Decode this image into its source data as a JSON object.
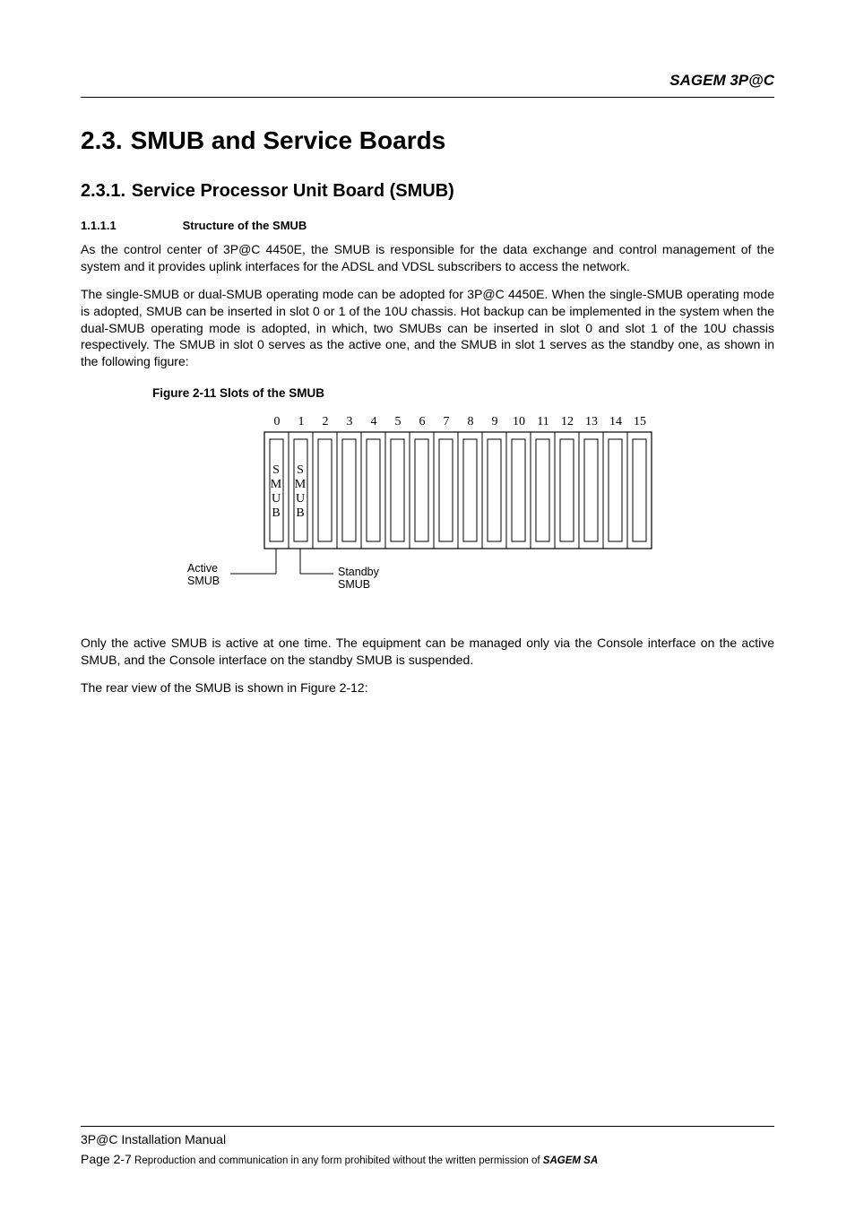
{
  "header": {
    "brand": "SAGEM 3P@C"
  },
  "section": {
    "num": "2.3.",
    "title": "SMUB and Service Boards"
  },
  "subsection": {
    "num": "2.3.1.",
    "title": "Service Processor Unit Board (SMUB)"
  },
  "struct": {
    "num": "1.1.1.1",
    "title": "Structure of the SMUB"
  },
  "para1": "As the control center of 3P@C 4450E, the SMUB is responsible for the data exchange and control management of the system and it provides uplink interfaces for the ADSL and VDSL subscribers to access the network.",
  "para2": "The single-SMUB or dual-SMUB operating mode can be adopted for 3P@C 4450E. When the single-SMUB operating mode is adopted, SMUB can be inserted in slot 0 or 1 of the 10U chassis. Hot backup can be implemented in the system when the dual-SMUB operating mode is adopted, in which, two SMUBs can be inserted in slot 0 and slot 1 of the 10U chassis respectively. The SMUB in slot 0 serves as the active one, and the SMUB in slot 1 serves as the standby one, as shown in the following figure:",
  "figure": {
    "caption": "Figure 2-11 Slots of the SMUB",
    "slot_numbers": [
      "0",
      "1",
      "2",
      "3",
      "4",
      "5",
      "6",
      "7",
      "8",
      "9",
      "10",
      "11",
      "12",
      "13",
      "14",
      "15"
    ],
    "slot0_label": "S\nM\nU\nB",
    "slot1_label": "S\nM\nU\nB",
    "active_label": "Active\nSMUB",
    "standby_label": "Standby\nSMUB"
  },
  "para3": "Only the active SMUB is active at one time. The equipment can be managed only via the Console interface on the active SMUB, and the Console interface on the standby SMUB is suspended.",
  "para4": "The rear view of the SMUB is shown in Figure 2-12:",
  "footer": {
    "line1": "3P@C Installation Manual",
    "page": "Page 2-7",
    "rights_pre": " Reproduction and communication in any form prohibited without the written permission of ",
    "rights_owner": "SAGEM SA"
  }
}
